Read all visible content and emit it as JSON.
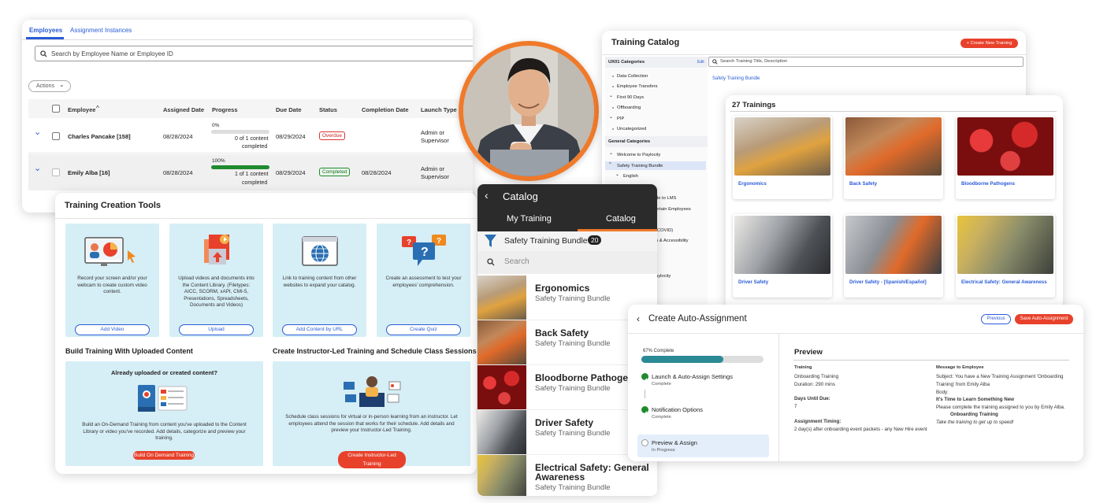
{
  "employees": {
    "tabs": [
      "Employees",
      "Assignment Instances"
    ],
    "search_placeholder": "Search by Employee Name or Employee ID",
    "actions_label": "Actions",
    "columns": [
      "Employee",
      "Assigned Date",
      "Progress",
      "Due Date",
      "Status",
      "Completion Date",
      "Launch Type"
    ],
    "rows": [
      {
        "name": "Charles Pancake [158]",
        "assigned": "08/28/2024",
        "pct_label": "0%",
        "progress": 0,
        "content": "0 of 1 content",
        "completed": "completed",
        "due": "08/29/2024",
        "status": "Overdue",
        "completion": "",
        "launch1": "Admin or",
        "launch2": "Supervisor"
      },
      {
        "name": "Emily Alba [16]",
        "assigned": "08/28/2024",
        "pct_label": "100%",
        "progress": 100,
        "content": "1 of 1 content",
        "completed": "completed",
        "due": "08/29/2024",
        "status": "Completed",
        "completion": "08/28/2024",
        "launch1": "Admin or",
        "launch2": "Supervisor"
      }
    ]
  },
  "tools": {
    "title": "Training Creation Tools",
    "tiles": [
      {
        "text": "Record your screen and/or your webcam to create custom video content.",
        "button": "Add Video"
      },
      {
        "text": "Upload videos and documents into the Content Library. (Filetypes: AICC, SCORM, xAPI, CMI-5, Presentations, Spreadsheets, Documents and Videos)",
        "button": "Upload"
      },
      {
        "text": "Link to training content from other websites to expand your catalog.",
        "button": "Add Content by URL"
      },
      {
        "text": "Create an assessment to test your employees' comprehension.",
        "button": "Create Quiz"
      }
    ],
    "section1_title": "Build Training With Uploaded Content",
    "section1_heading": "Already uploaded or created content?",
    "section1_text": "Build an On-Demand Training from content you've uploaded to the Content Library or video you've recorded. Add details, categorize and preview your training.",
    "section1_button": "Build On Demand Training",
    "section2_title": "Create Instructor-Led Training and Schedule Class Sessions",
    "section2_text": "Schedule class sessions for virtual or in-person learning from an instructor. Let employees attend the session that works for their schedule. Add details and preview your Instructor-Led Training.",
    "section2_button": "Create Instructor-Led Training"
  },
  "catalog": {
    "title": "Training Catalog",
    "create_button": "+ Create New Training",
    "ux_categories_label": "UX01 Categories",
    "edit_label": "Edit",
    "ux_items": [
      "Data Collection",
      "Employee Transfers",
      "First 90 Days",
      "Offboarding",
      "PIP",
      "Uncategorized"
    ],
    "general_label": "General Categories",
    "general_items": [
      "Welcome to Paylocity",
      "Safety Training Bundle",
      "English"
    ],
    "partial_items": [
      "de to LMS",
      "ertain Employees",
      "(COVID)",
      "n & Accessibility",
      "aylocity"
    ],
    "search_placeholder": "Search Training Title, Description",
    "breadcrumb": "Safety Training Bundle",
    "count_label": "27 Trainings",
    "cards": [
      "Ergonomics",
      "Back Safety",
      "Bloodborne Pathogens",
      "Driver Safety",
      "Driver Safety - [Spanish/Español]",
      "Electrical Safety: General Awareness"
    ]
  },
  "mobile": {
    "title": "Catalog",
    "tabs": [
      "My Training",
      "Catalog"
    ],
    "filter_label": "Safety Training Bundle",
    "filter_count": "20",
    "search_placeholder": "Search",
    "items": [
      {
        "title": "Ergonomics",
        "sub": "Safety Training Bundle"
      },
      {
        "title": "Back Safety",
        "sub": "Safety Training Bundle"
      },
      {
        "title": "Bloodborne Pathogens",
        "sub": "Safety Training Bundle"
      },
      {
        "title": "Driver Safety",
        "sub": "Safety Training Bundle"
      },
      {
        "title": "Electrical Safety: General Awareness",
        "sub": "Safety Training Bundle"
      }
    ]
  },
  "auto": {
    "title": "Create Auto-Assignment",
    "previous_button": "Previous",
    "save_button": "Save Auto-Assignment",
    "progress_label": "67% Complete",
    "progress": 67,
    "steps": [
      {
        "title": "Launch & Auto-Assign Settings",
        "status": "Complete"
      },
      {
        "title": "Notification Options",
        "status": "Complete"
      },
      {
        "title": "Preview & Assign",
        "status": "In Progress"
      }
    ],
    "preview_title": "Preview",
    "training_label": "Training",
    "training_name": "Onboarding Training",
    "duration": "Duration: 290 mins",
    "days_label": "Days Until Due:",
    "days_value": "7",
    "timing_label": "Assignment Timing:",
    "timing_value": "2 day(s) after onboarding event packets - any New Hire event",
    "message_label": "Message to Employee",
    "subject": "Subject: You have a New Training Assignment 'Onboarding Training' from Emily Alba",
    "body_label": "Body:",
    "body_heading": "It's Time to Learn Something New",
    "body_text": "Please complete the training assigned to you by Emily Alba.",
    "body_bold": "Onboarding Training",
    "body_italic": "Take the training to get up to speed!"
  },
  "colors": {
    "accent": "#2a5bd7",
    "brand_red": "#e8412b",
    "success": "#1f8a2e",
    "tile_bg": "#d6eef6",
    "mobile_dark": "#2b2b2b"
  }
}
